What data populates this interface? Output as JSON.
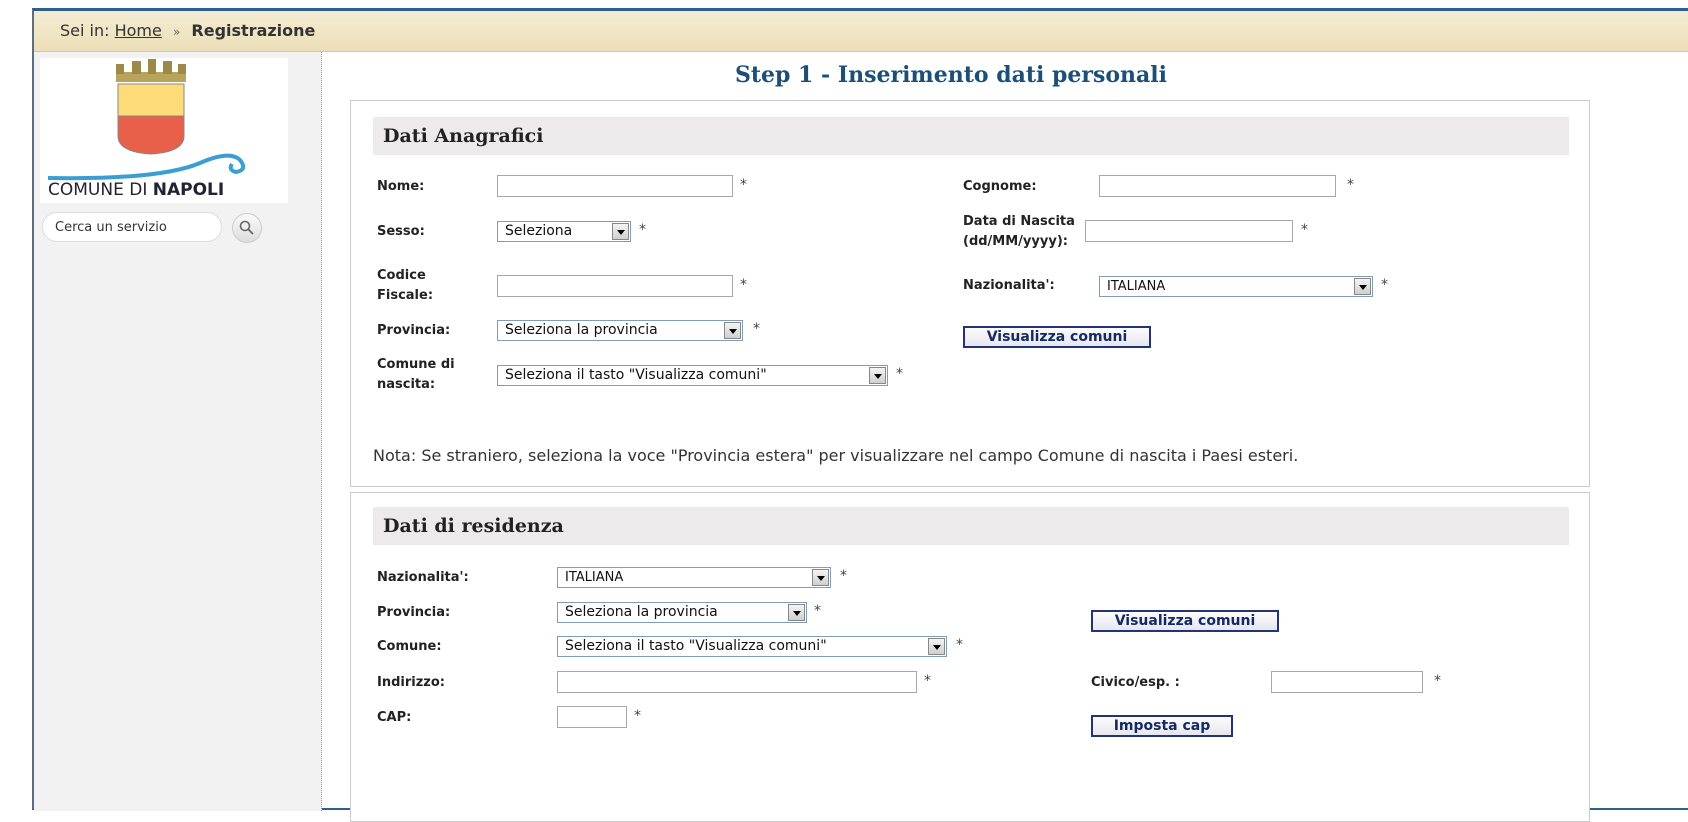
{
  "breadcrumb": {
    "prefix": "Sei in:",
    "home": "Home",
    "separator": "»",
    "current": "Registrazione"
  },
  "logo": {
    "text_plain": "COMUNE DI ",
    "text_bold": "NAPOLI",
    "colors": {
      "yellow": "#ffdc7a",
      "red": "#e8604a",
      "wave": "#3a9ed3",
      "gold": "#b8a35a"
    }
  },
  "search": {
    "placeholder": "Cerca un servizio"
  },
  "page": {
    "title": "Step 1 - Inserimento dati personali"
  },
  "anagrafici": {
    "title": "Dati Anagrafici",
    "nome_label": "Nome:",
    "cognome_label": "Cognome:",
    "sesso_label": "Sesso:",
    "sesso_value": "Seleziona",
    "nascita_label_1": "Data di Nascita",
    "nascita_label_2": "(dd/MM/yyyy):",
    "cf_label_1": "Codice",
    "cf_label_2": "Fiscale:",
    "naz_label": "Nazionalita':",
    "naz_value": "ITALIANA",
    "prov_label": "Provincia:",
    "prov_value": "Seleziona la provincia",
    "visualizza_label": "Visualizza comuni",
    "comune_label_1": "Comune di",
    "comune_label_2": "nascita:",
    "comune_value": "Seleziona il tasto \"Visualizza comuni\"",
    "nota": "Nota: Se straniero, seleziona la voce \"Provincia estera\" per visualizzare nel campo Comune di nascita i Paesi esteri."
  },
  "residenza": {
    "title": "Dati di residenza",
    "naz_label": "Nazionalita':",
    "naz_value": "ITALIANA",
    "prov_label": "Provincia:",
    "prov_value": "Seleziona la provincia",
    "visualizza_label": "Visualizza comuni",
    "comune_label": "Comune:",
    "comune_value": "Seleziona il tasto \"Visualizza comuni\"",
    "indirizzo_label": "Indirizzo:",
    "civico_label": "Civico/esp. :",
    "cap_label": "CAP:",
    "imposta_label": "Imposta cap"
  },
  "required_mark": "*"
}
